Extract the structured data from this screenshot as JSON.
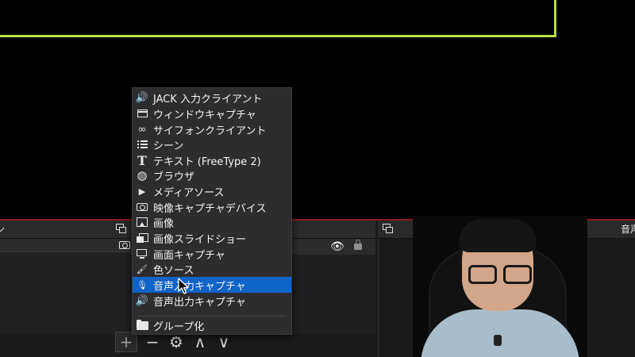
{
  "docks": {
    "scenes_title": "ン",
    "mixer_title": "音声"
  },
  "context_menu": {
    "items": [
      {
        "label": "JACK 入力クライアント",
        "icon": "speaker-icon"
      },
      {
        "label": "ウィンドウキャプチャ",
        "icon": "window-icon"
      },
      {
        "label": "サイフォンクライアント",
        "icon": "syphon-icon"
      },
      {
        "label": "シーン",
        "icon": "list-icon"
      },
      {
        "label": "テキスト (FreeType 2)",
        "icon": "text-icon"
      },
      {
        "label": "ブラウザ",
        "icon": "globe-icon"
      },
      {
        "label": "メディアソース",
        "icon": "play-icon"
      },
      {
        "label": "映像キャプチャデバイス",
        "icon": "camera-icon"
      },
      {
        "label": "画像",
        "icon": "image-icon"
      },
      {
        "label": "画像スライドショー",
        "icon": "slideshow-icon"
      },
      {
        "label": "画面キャプチャ",
        "icon": "monitor-icon"
      },
      {
        "label": "色ソース",
        "icon": "brush-icon"
      },
      {
        "label": "音声入力キャプチャ",
        "icon": "microphone-icon",
        "highlighted": true
      },
      {
        "label": "音声出力キャプチャ",
        "icon": "speaker-icon"
      },
      {
        "label": "グループ化",
        "icon": "folder-icon"
      }
    ]
  },
  "sources_toolbar": {
    "add": "+",
    "remove": "−",
    "settings": "⚙",
    "move_up": "∧",
    "move_down": "∨"
  },
  "glyphs": {
    "speaker": "🔊",
    "syphon": "∞",
    "text": "T",
    "globe": "◍",
    "play": "▶",
    "brush": "🖌",
    "mic": "🎙",
    "eye": "👁"
  },
  "colors": {
    "highlight": "#1063c8",
    "preview_border": "#b6e03b",
    "menu_bg": "#2d2d30"
  }
}
